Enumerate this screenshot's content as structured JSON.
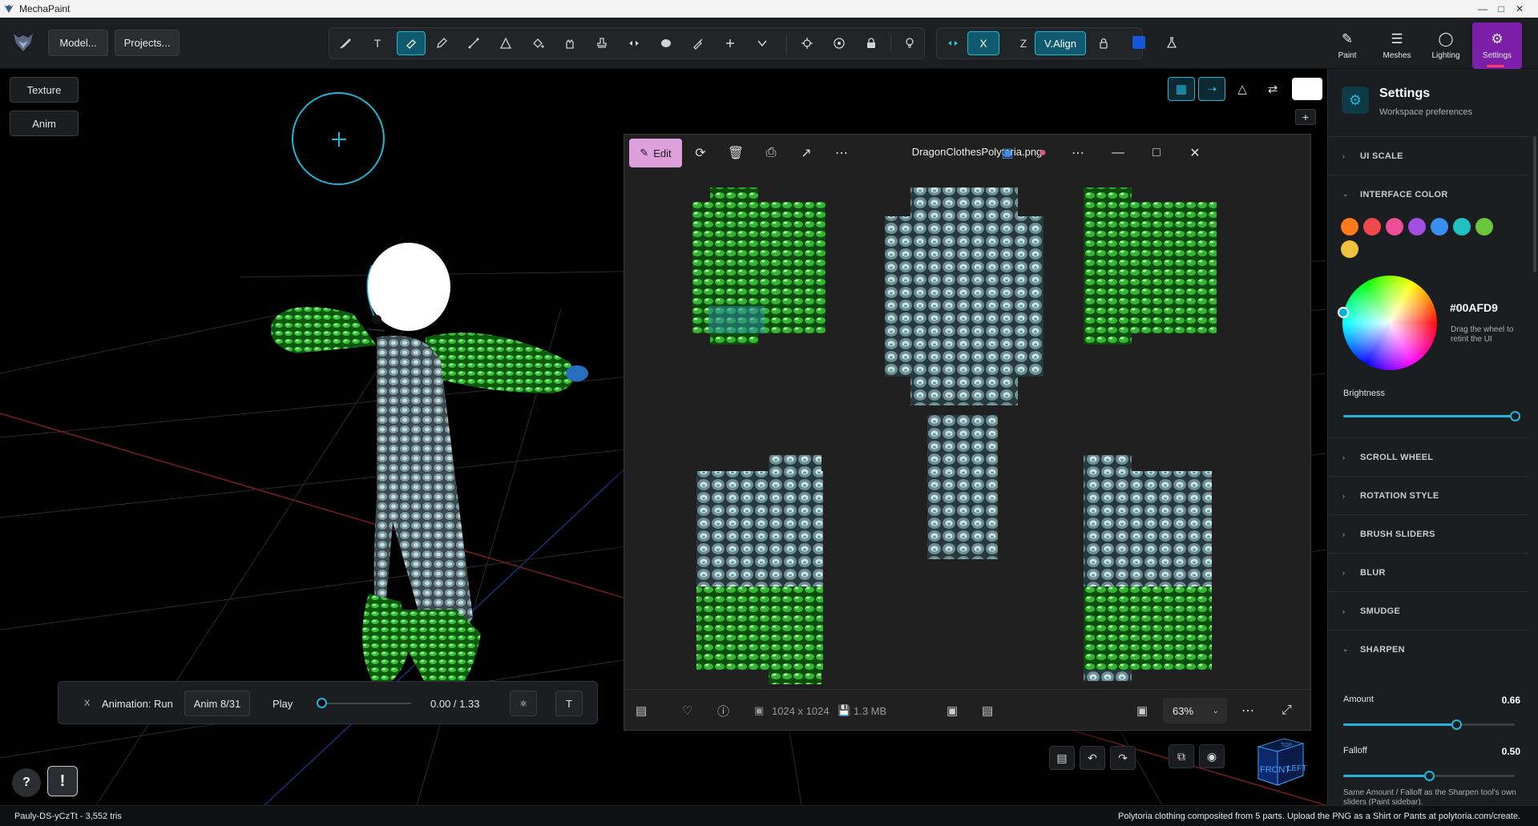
{
  "window": {
    "title": "MechaPaint"
  },
  "toolbar": {
    "model_button": "Model...",
    "projects_button": "Projects...",
    "tools": [
      {
        "icon": "brush-icon",
        "label": ""
      },
      {
        "icon": "text-icon",
        "label": "T"
      },
      {
        "icon": "eraser-icon",
        "label": ""
      },
      {
        "icon": "pen-icon",
        "label": ""
      },
      {
        "icon": "line-icon",
        "label": ""
      },
      {
        "icon": "triangle-icon",
        "label": ""
      },
      {
        "icon": "fill-bucket-icon",
        "label": ""
      },
      {
        "icon": "smudge-hand-icon",
        "label": ""
      },
      {
        "icon": "stamp-icon",
        "label": ""
      },
      {
        "icon": "mirror-icon",
        "label": ""
      },
      {
        "icon": "blob-icon",
        "label": ""
      },
      {
        "icon": "eyedropper-icon",
        "label": ""
      },
      {
        "icon": "plus-icon",
        "label": ""
      },
      {
        "icon": "chevron-down-icon",
        "label": ""
      }
    ],
    "symmetry": {
      "x_label": "X",
      "z_label": "Z",
      "valign_label": "V.Align"
    },
    "accent_color": "#00AFD9"
  },
  "mode_tabs": [
    {
      "label": "Paint",
      "icon": "brush-icon"
    },
    {
      "label": "Meshes",
      "icon": "layers-icon"
    },
    {
      "label": "Lighting",
      "icon": "bulb-icon"
    },
    {
      "label": "Settings",
      "icon": "gear-icon",
      "active": true
    }
  ],
  "viewport": {
    "texture_button": "Texture",
    "anim_button": "Anim",
    "animation": {
      "close_label": "X",
      "name": "Animation: Run",
      "counter": "Anim 8/31",
      "play_label": "Play",
      "time": "0.00 / 1.33",
      "t_label": "T",
      "progress": 0
    },
    "help_label": "?",
    "alert_label": "!",
    "navcube": {
      "top": "TOP",
      "front": "FRONT",
      "left": "LEFT"
    }
  },
  "viewer": {
    "edit_label": "Edit",
    "filename": "DragonClothesPolytoria.png",
    "dimensions": "1024 x 1024",
    "filesize": "1.3 MB",
    "zoom": "63%"
  },
  "settings": {
    "title": "Settings",
    "subtitle": "Workspace preferences",
    "sections_top": [
      "UI SCALE",
      "INTERFACE COLOR"
    ],
    "swatches": [
      "#FF7A1A",
      "#F0494C",
      "#EE4E95",
      "#A04FE0",
      "#3B8FF0",
      "#1FC1C1",
      "#6BC63B",
      "#F0C23C"
    ],
    "hex": "#00AFD9",
    "hex_hint": "Drag the wheel to retint the UI",
    "brightness_label": "Brightness",
    "brightness": 1.0,
    "sections_mid": [
      "SCROLL WHEEL",
      "ROTATION STYLE",
      "BRUSH SLIDERS",
      "BLUR",
      "SMUDGE",
      "SHARPEN"
    ],
    "amount_label": "Amount",
    "amount": "0.66",
    "falloff_label": "Falloff",
    "falloff": "0.50",
    "note": "Same Amount / Falloff as the Sharpen tool's own sliders (Paint sidebar)."
  },
  "status": {
    "left": "Pauly-DS-yCzTt  -  3,552 tris",
    "right": "Polytoria clothing composited from 5 parts. Upload the PNG as a Shirt or Pants at polytoria.com/create."
  }
}
